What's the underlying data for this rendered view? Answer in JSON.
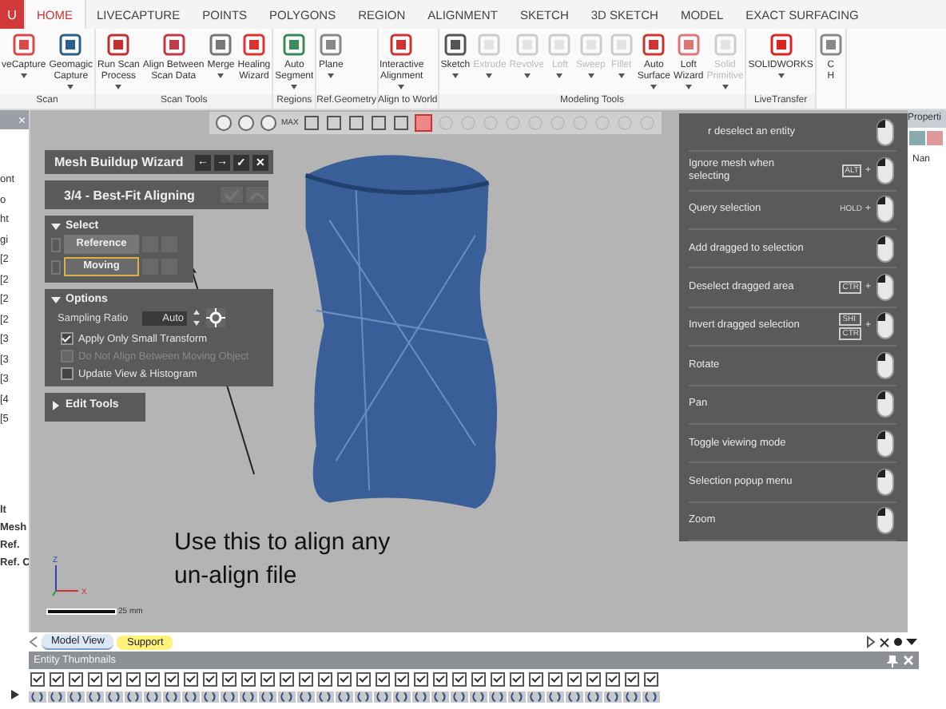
{
  "menu_tabs": {
    "app_button": "U",
    "tabs": [
      {
        "label": "HOME",
        "selected": true
      },
      {
        "label": "LIVECAPTURE",
        "selected": false
      },
      {
        "label": "POINTS",
        "selected": false
      },
      {
        "label": "POLYGONS",
        "selected": false
      },
      {
        "label": "REGION",
        "selected": false
      },
      {
        "label": "ALIGNMENT",
        "selected": false
      },
      {
        "label": "SKETCH",
        "selected": false
      },
      {
        "label": "3D SKETCH",
        "selected": false
      },
      {
        "label": "MODEL",
        "selected": false
      },
      {
        "label": "EXACT SURFACING",
        "selected": false
      }
    ]
  },
  "ribbon": {
    "groups": [
      {
        "label": "Scan",
        "buttons": [
          {
            "label": "veCapture",
            "dropdown": true,
            "disabled": false
          },
          {
            "label": "Geomagic\nCapture",
            "dropdown": true,
            "disabled": false
          }
        ]
      },
      {
        "label": "Scan Tools",
        "buttons": [
          {
            "label": "Run Scan\nProcess",
            "dropdown": true,
            "disabled": false
          },
          {
            "label": "Align Between\nScan Data",
            "dropdown": false,
            "disabled": false
          },
          {
            "label": "Merge",
            "dropdown": true,
            "disabled": false
          },
          {
            "label": "Healing\nWizard",
            "dropdown": false,
            "disabled": false
          }
        ]
      },
      {
        "label": "Regions",
        "buttons": [
          {
            "label": "Auto\nSegment",
            "dropdown": true,
            "disabled": false
          }
        ]
      },
      {
        "label": "Ref.Geometry",
        "buttons": [
          {
            "label": "Plane",
            "dropdown": true,
            "disabled": false
          }
        ]
      },
      {
        "label": "Align to World",
        "buttons": [
          {
            "label": "Interactive\nAlignment",
            "dropdown": true,
            "disabled": false
          }
        ]
      },
      {
        "label": "Modeling Tools",
        "buttons": [
          {
            "label": "Sketch",
            "dropdown": true,
            "disabled": false
          },
          {
            "label": "Extrude",
            "dropdown": true,
            "disabled": true
          },
          {
            "label": "Revolve",
            "dropdown": true,
            "disabled": true
          },
          {
            "label": "Loft",
            "dropdown": true,
            "disabled": true
          },
          {
            "label": "Sweep",
            "dropdown": true,
            "disabled": true
          },
          {
            "label": "Fillet",
            "dropdown": true,
            "disabled": true
          },
          {
            "label": "Auto\nSurface",
            "dropdown": true,
            "disabled": false
          },
          {
            "label": "Loft\nWizard",
            "dropdown": true,
            "disabled": false
          },
          {
            "label": "Solid\nPrimitive",
            "dropdown": true,
            "disabled": true
          }
        ]
      },
      {
        "label": "LiveTransfer",
        "buttons": [
          {
            "label": "SOLIDWORKS",
            "dropdown": true,
            "disabled": false
          }
        ]
      },
      {
        "buttons": [
          {
            "label": "C\nH",
            "dropdown": false,
            "disabled": false
          }
        ]
      }
    ]
  },
  "tree_panel": {
    "close": "×",
    "items": [
      "ont",
      "o",
      "ht",
      "gi",
      "[2",
      "[2",
      "[2",
      "[2",
      "[3",
      "[3",
      "[3",
      "[4",
      "[5"
    ],
    "lower_items": [
      "lt",
      "Mesh",
      "Ref.",
      "Ref. C"
    ]
  },
  "viewport": {
    "toolbar_label": "MAX",
    "wizard": {
      "title": "Mesh Buildup Wizard",
      "actions": [
        "←",
        "→",
        "✓",
        "✕"
      ],
      "step": "3/4 - Best-Fit Aligning",
      "select": {
        "title": "Select",
        "expanded": true,
        "items": [
          {
            "label": "Reference",
            "selected": false
          },
          {
            "label": "Moving",
            "selected": true
          }
        ]
      },
      "options": {
        "title": "Options",
        "expanded": true,
        "sampling_label": "Sampling Ratio",
        "sampling_value": "Auto",
        "checks": [
          {
            "label": "Apply Only Small Transform",
            "checked": true,
            "disabled": false
          },
          {
            "label": "Do Not Align Between Moving Object",
            "checked": false,
            "disabled": true
          },
          {
            "label": "Update View & Histogram",
            "checked": false,
            "disabled": false
          }
        ]
      },
      "edit_tools": {
        "title": "Edit Tools",
        "expanded": false
      }
    },
    "annotation": "Use this to align any\nun-align file",
    "axis_z": "Z",
    "axis_x": "X",
    "scale": "25 mm"
  },
  "help_panel": {
    "rows": [
      {
        "label": "r deselect an entity",
        "keys": []
      },
      {
        "label": "Ignore mesh when selecting",
        "keys": [
          "ALT"
        ],
        "join": "+"
      },
      {
        "label": "Query selection",
        "hold": "HOLD",
        "join": "+",
        "keys": []
      },
      {
        "label": "Add dragged to selection",
        "keys": []
      },
      {
        "label": "Deselect dragged area",
        "keys": [
          "CTR"
        ],
        "join": "+"
      },
      {
        "label": "Invert dragged selection",
        "keys": [
          "SHI",
          "CTR"
        ],
        "join": "+"
      },
      {
        "label": "Rotate",
        "keys": []
      },
      {
        "label": "Pan",
        "keys": []
      },
      {
        "label": "Toggle viewing mode",
        "keys": []
      },
      {
        "label": "Selection popup menu",
        "keys": []
      },
      {
        "label": "Zoom",
        "keys": []
      }
    ]
  },
  "properties_panel": {
    "title": "Properti",
    "column": "Nan"
  },
  "doc_tabs": [
    {
      "label": "Model View",
      "selected": true,
      "color": "#dce8f6"
    },
    {
      "label": "Support",
      "selected": false,
      "color": "#fff27a"
    }
  ],
  "thumbnails": {
    "title": "Entity Thumbnails",
    "items": [
      {
        "checked": true
      },
      {
        "checked": true
      },
      {
        "checked": true
      },
      {
        "checked": true
      },
      {
        "checked": true
      },
      {
        "checked": true
      },
      {
        "checked": true
      },
      {
        "checked": true
      },
      {
        "checked": true
      },
      {
        "checked": true
      },
      {
        "checked": true
      },
      {
        "checked": true
      },
      {
        "checked": true
      },
      {
        "checked": true
      },
      {
        "checked": true
      },
      {
        "checked": true
      },
      {
        "checked": true
      },
      {
        "checked": true
      },
      {
        "checked": true
      },
      {
        "checked": true
      },
      {
        "checked": true
      },
      {
        "checked": true
      },
      {
        "checked": true
      },
      {
        "checked": true
      },
      {
        "checked": true
      },
      {
        "checked": true
      },
      {
        "checked": true
      },
      {
        "checked": true
      },
      {
        "checked": true
      },
      {
        "checked": true
      },
      {
        "checked": true
      },
      {
        "checked": true
      },
      {
        "checked": true
      }
    ]
  }
}
